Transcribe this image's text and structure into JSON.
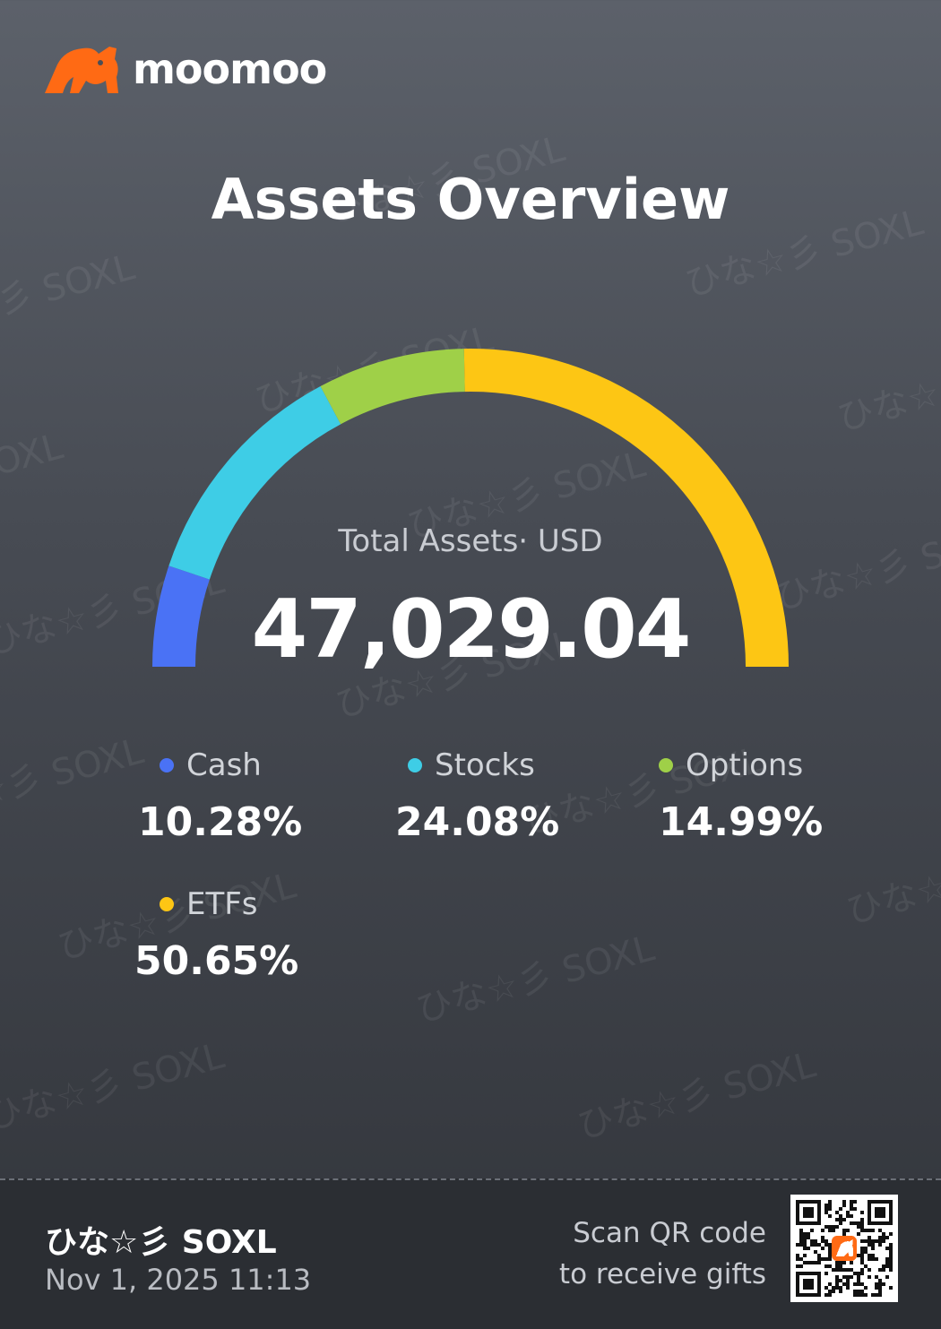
{
  "brand": {
    "name": "moomoo",
    "accent": "#ff6a14"
  },
  "page": {
    "title": "Assets Overview"
  },
  "summary": {
    "label": "Total Assets· USD",
    "value": "47,029.04"
  },
  "allocation": [
    {
      "name": "Cash",
      "percent_label": "10.28%",
      "percent": 10.28,
      "color": "#4a72f5"
    },
    {
      "name": "Stocks",
      "percent_label": "24.08%",
      "percent": 24.08,
      "color": "#3ecde6"
    },
    {
      "name": "Options",
      "percent_label": "14.99%",
      "percent": 14.99,
      "color": "#9fd048"
    },
    {
      "name": "ETFs",
      "percent_label": "50.65%",
      "percent": 50.65,
      "color": "#fdc614"
    }
  ],
  "watermark": "ひな☆彡 SOXL",
  "footer": {
    "user_name": "ひな☆彡 SOXL",
    "datetime": "Nov 1, 2025 11:13",
    "scan_line1": "Scan QR code",
    "scan_line2": "to receive gifts"
  },
  "icons": {
    "logo": "moomoo-bull-logo",
    "qr": "qr-code"
  }
}
